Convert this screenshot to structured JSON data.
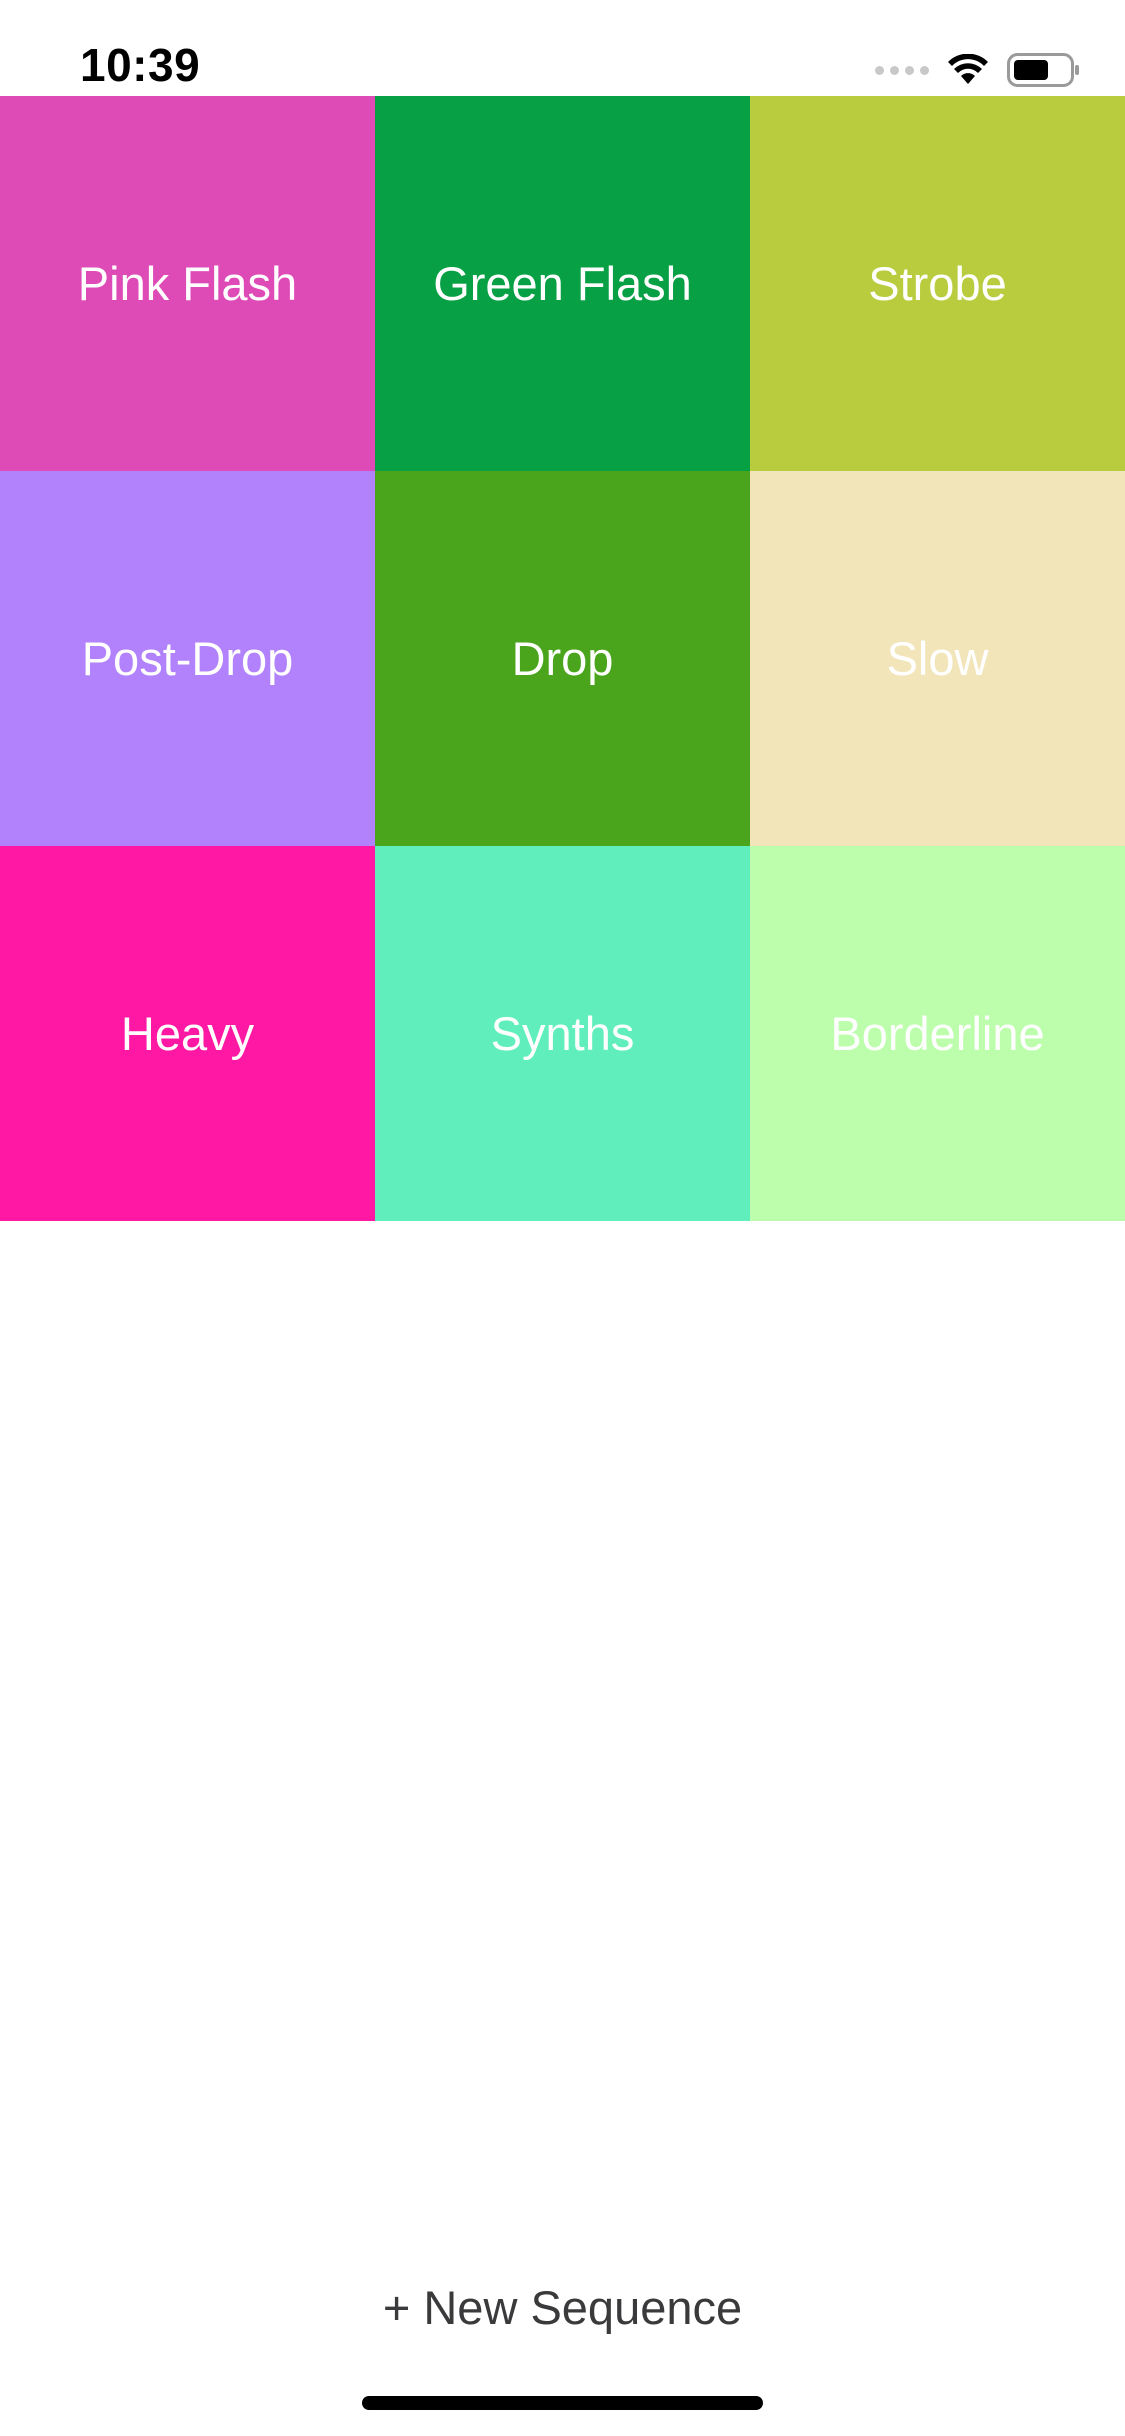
{
  "status_bar": {
    "time": "10:39",
    "icons": [
      "cellular-signal-icon",
      "wifi-icon",
      "battery-icon"
    ]
  },
  "sequences": [
    {
      "label": "Pink Flash",
      "color": "#DE4BB6"
    },
    {
      "label": "Green Flash",
      "color": "#08A044"
    },
    {
      "label": "Strobe",
      "color": "#B8CC3E"
    },
    {
      "label": "Post-Drop",
      "color": "#B182FB"
    },
    {
      "label": "Drop",
      "color": "#4AA51C"
    },
    {
      "label": "Slow",
      "color": "#F2E5B9"
    },
    {
      "label": "Heavy",
      "color": "#FE18A3"
    },
    {
      "label": "Synths",
      "color": "#60EFBC"
    },
    {
      "label": "Borderline",
      "color": "#BDFEAD"
    }
  ],
  "footer": {
    "new_sequence_label": "+ New Sequence"
  }
}
